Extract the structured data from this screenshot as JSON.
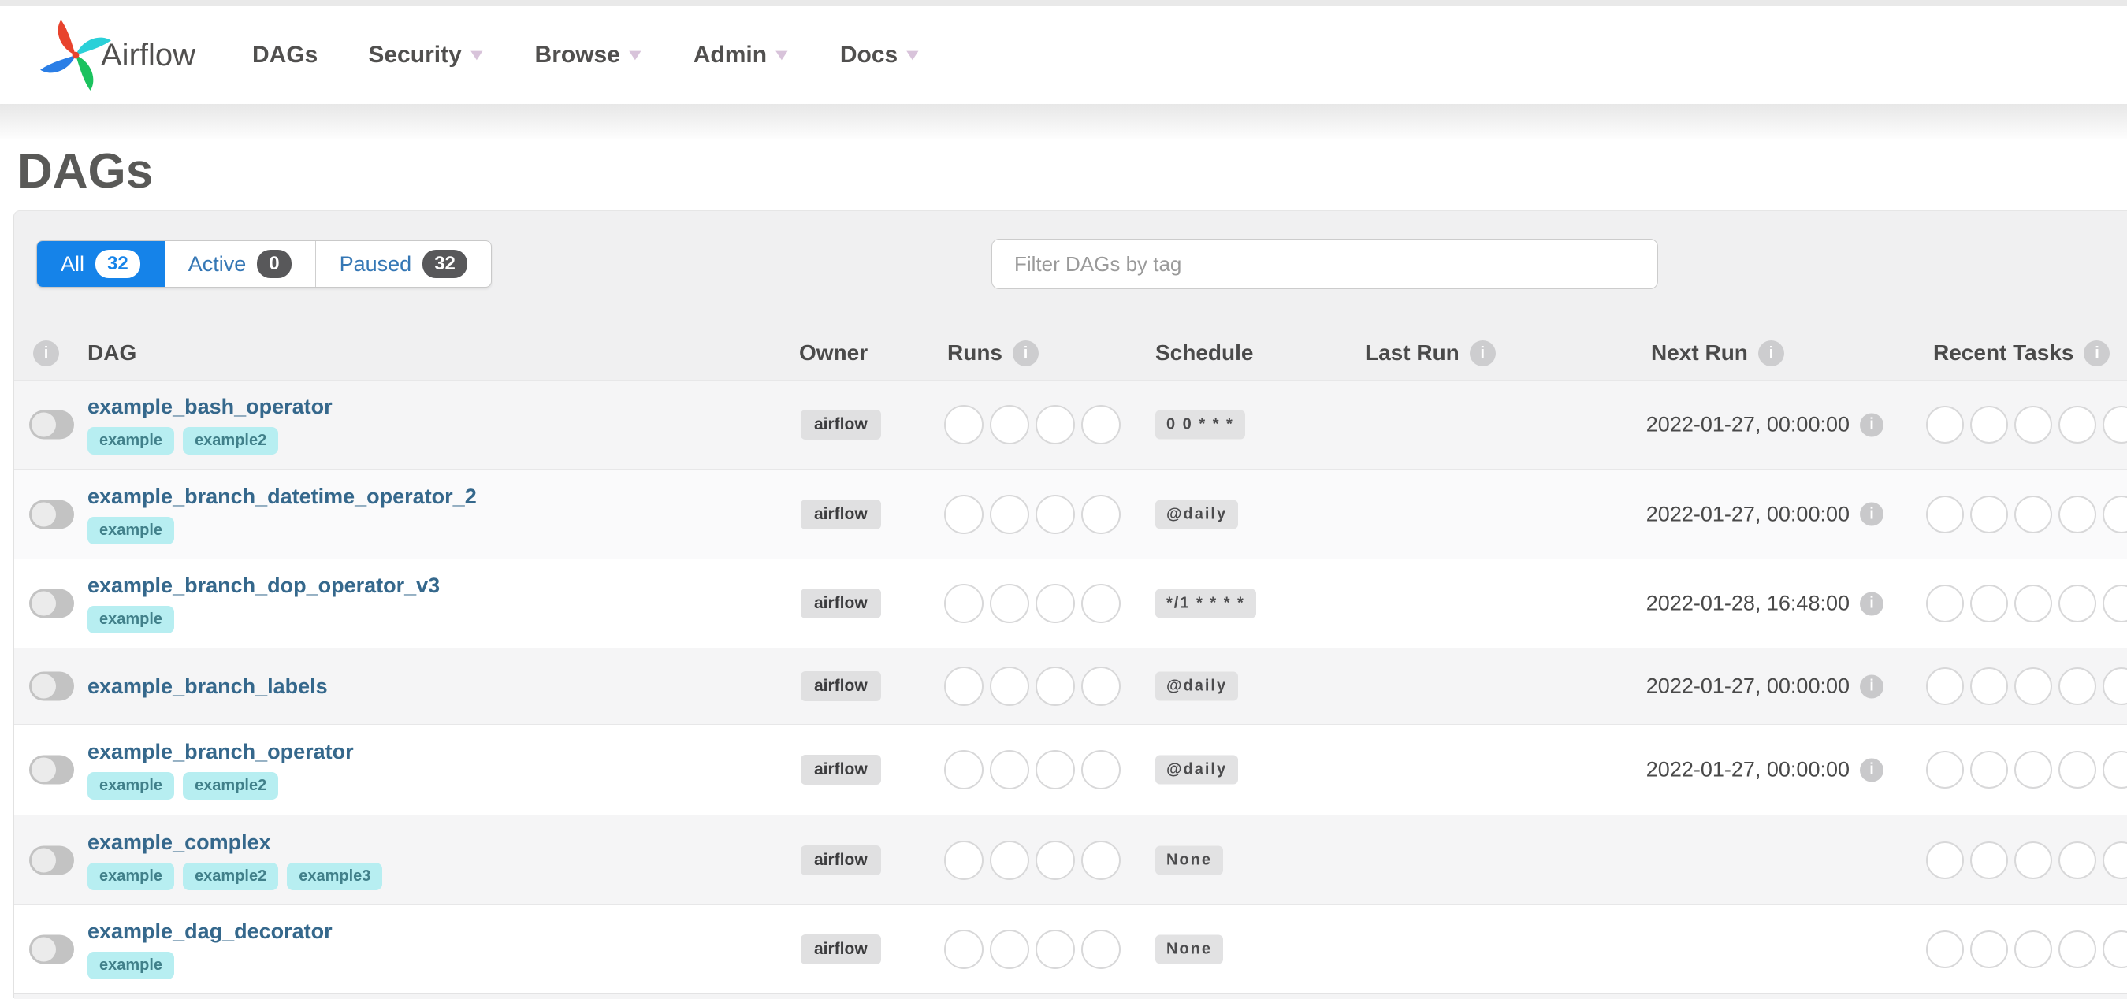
{
  "navbar": {
    "brand": "Airflow",
    "items": [
      {
        "label": "DAGs",
        "caret": false
      },
      {
        "label": "Security",
        "caret": true
      },
      {
        "label": "Browse",
        "caret": true
      },
      {
        "label": "Admin",
        "caret": true
      },
      {
        "label": "Docs",
        "caret": true
      }
    ]
  },
  "page": {
    "title": "DAGs"
  },
  "filter_tabs": [
    {
      "label": "All",
      "count": "32",
      "active": true
    },
    {
      "label": "Active",
      "count": "0",
      "active": false
    },
    {
      "label": "Paused",
      "count": "32",
      "active": false
    }
  ],
  "tag_filter": {
    "placeholder": "Filter DAGs by tag"
  },
  "table": {
    "headers": {
      "dag": "DAG",
      "owner": "Owner",
      "runs": "Runs",
      "schedule": "Schedule",
      "last_run": "Last Run",
      "next_run": "Next Run",
      "recent_tasks": "Recent Tasks"
    },
    "info_icon_glyph": "i",
    "runs_slots": 4,
    "recent_task_slots": 5
  },
  "colors": {
    "accent_blue": "#1583e9",
    "dag_link": "#35688c",
    "tag_bg": "#b7eef1",
    "tag_text": "#41808a"
  },
  "rows": [
    {
      "name": "example_bash_operator",
      "tags": [
        "example",
        "example2"
      ],
      "owner": "airflow",
      "schedule": "0 0 * * *",
      "last_run": "",
      "next_run": "2022-01-27, 00:00:00",
      "shade": "shade"
    },
    {
      "name": "example_branch_datetime_operator_2",
      "tags": [
        "example"
      ],
      "owner": "airflow",
      "schedule": "@daily",
      "last_run": "",
      "next_run": "2022-01-27, 00:00:00",
      "shade": "shade-light"
    },
    {
      "name": "example_branch_dop_operator_v3",
      "tags": [
        "example"
      ],
      "owner": "airflow",
      "schedule": "*/1 * * * *",
      "last_run": "",
      "next_run": "2022-01-28, 16:48:00",
      "shade": ""
    },
    {
      "name": "example_branch_labels",
      "tags": [],
      "owner": "airflow",
      "schedule": "@daily",
      "last_run": "",
      "next_run": "2022-01-27, 00:00:00",
      "shade": "shade"
    },
    {
      "name": "example_branch_operator",
      "tags": [
        "example",
        "example2"
      ],
      "owner": "airflow",
      "schedule": "@daily",
      "last_run": "",
      "next_run": "2022-01-27, 00:00:00",
      "shade": ""
    },
    {
      "name": "example_complex",
      "tags": [
        "example",
        "example2",
        "example3"
      ],
      "owner": "airflow",
      "schedule": "None",
      "last_run": "",
      "next_run": "",
      "shade": "shade"
    },
    {
      "name": "example_dag_decorator",
      "tags": [
        "example"
      ],
      "owner": "airflow",
      "schedule": "None",
      "last_run": "",
      "next_run": "",
      "shade": ""
    }
  ]
}
